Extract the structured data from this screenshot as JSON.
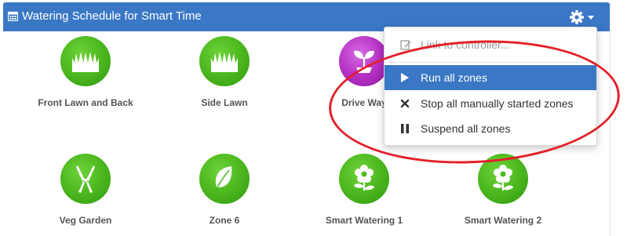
{
  "header": {
    "title": "Watering Schedule for Smart Time",
    "calendar_icon": "calendar-icon",
    "settings_icon": "gear-icon"
  },
  "zones": [
    {
      "label": "Front Lawn and Back",
      "icon": "grass-icon",
      "color": "#4fba20"
    },
    {
      "label": "Side Lawn",
      "icon": "grass-icon",
      "color": "#4fba20"
    },
    {
      "label": "Drive Way",
      "icon": "sprout-icon",
      "color": "#b530c4"
    },
    {
      "label": "Veg Garden",
      "icon": "shears-icon",
      "color": "#4fba20"
    },
    {
      "label": "Zone 6",
      "icon": "leaf-icon",
      "color": "#4fba20"
    },
    {
      "label": "Smart Watering 1",
      "icon": "flower-icon",
      "color": "#4fba20"
    },
    {
      "label": "Smart Watering 2",
      "icon": "flower-icon",
      "color": "#4fba20"
    }
  ],
  "menu": {
    "items": [
      {
        "label": "Link to controller...",
        "icon": "edit-icon"
      },
      {
        "label": "Run all zones",
        "icon": "play-icon"
      },
      {
        "label": "Stop all manually started zones",
        "icon": "close-icon"
      },
      {
        "label": "Suspend all zones",
        "icon": "pause-icon"
      }
    ]
  },
  "colors": {
    "header": "#3a78c6",
    "zone_green": "#4fba20",
    "zone_purple": "#b530c4",
    "annotation": "#e3202a"
  }
}
